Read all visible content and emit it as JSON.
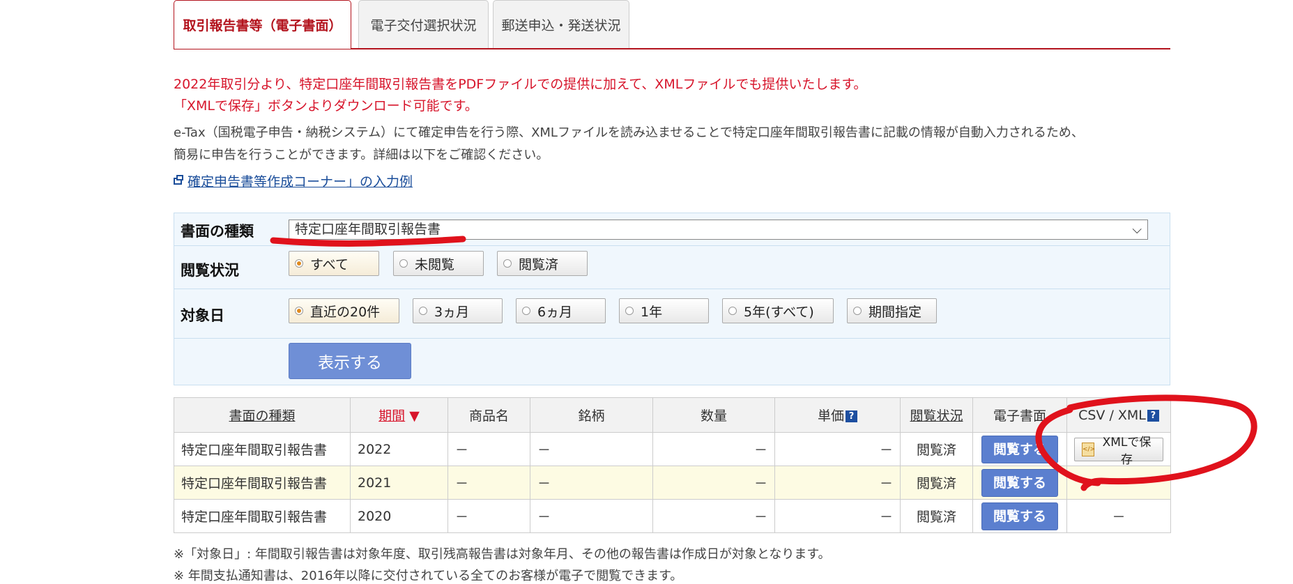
{
  "tabs": [
    {
      "label": "取引報告書等（電子書面）",
      "active": true
    },
    {
      "label": "電子交付選択状況",
      "active": false
    },
    {
      "label": "郵送申込・発送状況",
      "active": false
    }
  ],
  "notice": {
    "line1": "2022年取引分より、特定口座年間取引報告書をPDFファイルでの提供に加えて、XMLファイルでも提供いたします。",
    "line2": "「XMLで保存」ボタンよりダウンロード可能です。"
  },
  "description": {
    "line1": "e-Tax（国税電子申告・納税システム）にて確定申告を行う際、XMLファイルを読み込ませることで特定口座年間取引報告書に記載の情報が自動入力されるため、",
    "line2": "簡易に申告を行うことができます。詳細は以下をご確認ください。"
  },
  "link": {
    "label": "確定申告書等作成コーナー」の入力例",
    "icon": "external-window-icon"
  },
  "filters": {
    "doc_type_label": "書面の種類",
    "doc_type_value": "特定口座年間取引報告書",
    "view_status_label": "閲覧状況",
    "view_status_options": [
      "すべて",
      "未閲覧",
      "閲覧済"
    ],
    "view_status_selected": "すべて",
    "target_date_label": "対象日",
    "target_date_options": [
      "直近の20件",
      "3ヵ月",
      "6ヵ月",
      "1年",
      "5年(すべて)",
      "期間指定"
    ],
    "target_date_selected": "直近の20件",
    "submit_label": "表示する"
  },
  "table": {
    "headers": [
      "書面の種類",
      "期間",
      "商品名",
      "銘柄",
      "数量",
      "単価",
      "閲覧状況",
      "電子書面",
      "CSV / XML"
    ],
    "sort_indicator": "▼",
    "help_icon": "?",
    "view_button_label": "閲覧する",
    "xml_button_label": "XMLで保存",
    "rows": [
      {
        "doc_type": "特定口座年間取引報告書",
        "period": "2022",
        "product": "－",
        "brand": "－",
        "quantity": "－",
        "price": "－",
        "status": "閲覧済",
        "csv_xml": "XMLで保存"
      },
      {
        "doc_type": "特定口座年間取引報告書",
        "period": "2021",
        "product": "－",
        "brand": "－",
        "quantity": "－",
        "price": "－",
        "status": "閲覧済",
        "csv_xml": "－"
      },
      {
        "doc_type": "特定口座年間取引報告書",
        "period": "2020",
        "product": "－",
        "brand": "－",
        "quantity": "－",
        "price": "－",
        "status": "閲覧済",
        "csv_xml": "－"
      }
    ]
  },
  "footnotes": [
    "※「対象日」: 年間取引報告書は対象年度、取引残高報告書は対象年月、その他の報告書は作成日が対象となります。",
    "※ 年間支払通知書は、2016年以降に交付されている全てのお客様が電子で閲覧できます。"
  ],
  "colors": {
    "accent_red": "#b3131d",
    "notice_red": "#d7152b",
    "link_blue": "#1a4d9a",
    "button_blue": "#5b7fcf",
    "annotation_red": "#e0121c"
  }
}
